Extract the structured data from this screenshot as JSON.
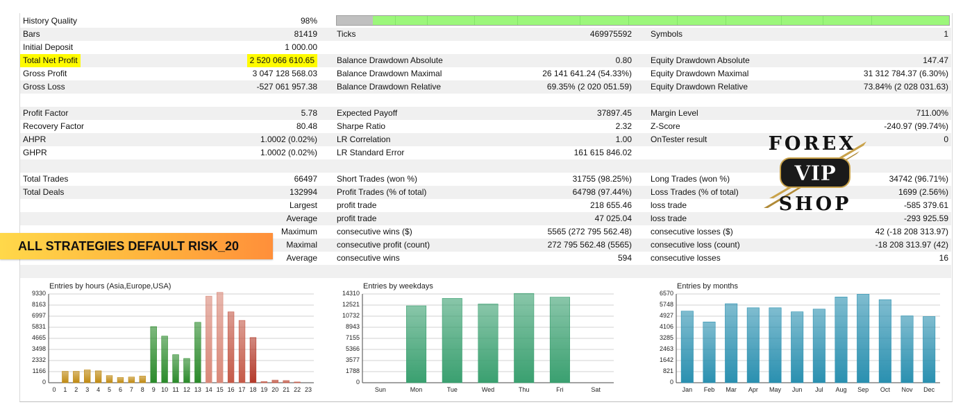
{
  "history": {
    "quality_label": "History Quality",
    "quality_value": "98%",
    "quality_fraction": 0.98
  },
  "stats_rows": [
    {
      "alt": true,
      "c1l": "Bars",
      "c1v": "81419",
      "c2l": "Ticks",
      "c2v": "469975592",
      "c3l": "Symbols",
      "c3v": "1"
    },
    {
      "alt": false,
      "c1l": "Initial Deposit",
      "c1v": "1 000.00",
      "c2l": "",
      "c2v": "",
      "c3l": "",
      "c3v": ""
    },
    {
      "alt": true,
      "c1l": "Total Net Profit",
      "c1v": "2 520 066 610.65",
      "c2l": "Balance Drawdown Absolute",
      "c2v": "0.80",
      "c3l": "Equity Drawdown Absolute",
      "c3v": "147.47",
      "highlight": true
    },
    {
      "alt": false,
      "c1l": "Gross Profit",
      "c1v": "3 047 128 568.03",
      "c2l": "Balance Drawdown Maximal",
      "c2v": "26 141 641.24 (54.33%)",
      "c3l": "Equity Drawdown Maximal",
      "c3v": "31 312 784.37 (6.30%)"
    },
    {
      "alt": true,
      "c1l": "Gross Loss",
      "c1v": "-527 061 957.38",
      "c2l": "Balance Drawdown Relative",
      "c2v": "69.35% (2 020 051.59)",
      "c3l": "Equity Drawdown Relative",
      "c3v": "73.84% (2 028 031.63)"
    },
    {
      "alt": false,
      "c1l": "",
      "c1v": "",
      "c2l": "",
      "c2v": "",
      "c3l": "",
      "c3v": ""
    },
    {
      "alt": true,
      "c1l": "Profit Factor",
      "c1v": "5.78",
      "c2l": "Expected Payoff",
      "c2v": "37897.45",
      "c3l": "Margin Level",
      "c3v": "711.00%"
    },
    {
      "alt": false,
      "c1l": "Recovery Factor",
      "c1v": "80.48",
      "c2l": "Sharpe Ratio",
      "c2v": "2.32",
      "c3l": "Z-Score",
      "c3v": "-240.97 (99.74%)"
    },
    {
      "alt": true,
      "c1l": "AHPR",
      "c1v": "1.0002 (0.02%)",
      "c2l": "LR Correlation",
      "c2v": "1.00",
      "c3l": "OnTester result",
      "c3v": "0"
    },
    {
      "alt": false,
      "c1l": "GHPR",
      "c1v": "1.0002 (0.02%)",
      "c2l": "LR Standard Error",
      "c2v": "161 615 846.02",
      "c3l": "",
      "c3v": ""
    },
    {
      "alt": true,
      "c1l": "",
      "c1v": "",
      "c2l": "",
      "c2v": "",
      "c3l": "",
      "c3v": ""
    },
    {
      "alt": false,
      "c1l": "Total Trades",
      "c1v": "66497",
      "c2l": "Short Trades (won %)",
      "c2v": "31755 (98.25%)",
      "c3l": "Long Trades (won %)",
      "c3v": "34742 (96.71%)"
    },
    {
      "alt": true,
      "c1l": "Total Deals",
      "c1v": "132994",
      "c2l": "Profit Trades (% of total)",
      "c2v": "64798 (97.44%)",
      "c3l": "Loss Trades (% of total)",
      "c3v": "1699 (2.56%)"
    },
    {
      "alt": false,
      "mid": "Largest",
      "c2l": "profit trade",
      "c2v": "218 655.46",
      "c3l": "loss trade",
      "c3v": "-585 379.61"
    },
    {
      "alt": true,
      "mid": "Average",
      "c2l": "profit trade",
      "c2v": "47 025.04",
      "c3l": "loss trade",
      "c3v": "-293 925.59"
    },
    {
      "alt": false,
      "mid": "Maximum",
      "c2l": "consecutive wins ($)",
      "c2v": "5565 (272 795 562.48)",
      "c3l": "consecutive losses ($)",
      "c3v": "42 (-18 208 313.97)"
    },
    {
      "alt": true,
      "mid": "Maximal",
      "c2l": "consecutive profit (count)",
      "c2v": "272 795 562.48 (5565)",
      "c3l": "consecutive loss (count)",
      "c3v": "-18 208 313.97 (42)"
    },
    {
      "alt": false,
      "mid": "Average",
      "c2l": "consecutive wins",
      "c2v": "594",
      "c3l": "consecutive losses",
      "c3v": "16"
    },
    {
      "alt": true,
      "c1l": "",
      "c1v": "",
      "c2l": "",
      "c2v": "",
      "c3l": "",
      "c3v": ""
    }
  ],
  "banner": {
    "text": "ALL STRATEGIES DEFAULT RISK_20"
  },
  "logo": {
    "line1": "FOREX",
    "line2": "VIP",
    "line3": "SHOP",
    "icon": "forex-vip-shop-logo",
    "gold": "#c9a24a"
  },
  "charts": [
    {
      "title": "Entries by hours (Asia,Europe,USA)",
      "y_ticks": [
        "9330",
        "8163",
        "6997",
        "5831",
        "4665",
        "3498",
        "2332",
        "1166",
        "0"
      ],
      "ymax": 9330,
      "categories": [
        "0",
        "1",
        "2",
        "3",
        "4",
        "5",
        "6",
        "7",
        "8",
        "9",
        "10",
        "11",
        "12",
        "13",
        "14",
        "15",
        "16",
        "17",
        "18",
        "19",
        "20",
        "21",
        "22",
        "23"
      ],
      "values": [
        0,
        1200,
        1200,
        1350,
        1250,
        750,
        550,
        600,
        700,
        5900,
        4900,
        2950,
        2550,
        6350,
        9100,
        9500,
        7450,
        6550,
        4750,
        120,
        280,
        230,
        80,
        0
      ],
      "colors": [
        "#c08a12",
        "#c08a12",
        "#c08a12",
        "#c08a12",
        "#c08a12",
        "#c08a12",
        "#c08a12",
        "#c08a12",
        "#c08a12",
        "#2a8a2a",
        "#2a8a2a",
        "#2a8a2a",
        "#2a8a2a",
        "#2a8a2a",
        "#d98878",
        "#d98878",
        "#c55a48",
        "#c55a48",
        "#b43a2a",
        "#c55a48",
        "#c55a48",
        "#c55a48",
        "#c55a48",
        "#c55a48"
      ]
    },
    {
      "title": "Entries by weekdays",
      "y_ticks": [
        "14310",
        "12521",
        "10732",
        "8943",
        "7155",
        "5366",
        "3577",
        "1788",
        "0"
      ],
      "ymax": 14310,
      "categories": [
        "Sun",
        "Mon",
        "Tue",
        "Wed",
        "Thu",
        "Fri",
        "Sat"
      ],
      "values": [
        0,
        12400,
        13600,
        12700,
        14400,
        13800,
        0
      ],
      "colors": [
        "#3aa070",
        "#3aa070",
        "#3aa070",
        "#3aa070",
        "#3aa070",
        "#3aa070",
        "#3aa070"
      ]
    },
    {
      "title": "Entries by months",
      "y_ticks": [
        "6570",
        "5748",
        "4927",
        "4106",
        "3285",
        "2463",
        "1642",
        "821",
        "0"
      ],
      "ymax": 6570,
      "categories": [
        "Jan",
        "Feb",
        "Mar",
        "Apr",
        "May",
        "Jun",
        "Jul",
        "Aug",
        "Sep",
        "Oct",
        "Nov",
        "Dec"
      ],
      "values": [
        5300,
        4500,
        5850,
        5550,
        5550,
        5250,
        5450,
        6350,
        6550,
        6150,
        4950,
        4900
      ],
      "colors": [
        "#2a90b0",
        "#2a90b0",
        "#2a90b0",
        "#2a90b0",
        "#2a90b0",
        "#2a90b0",
        "#2a90b0",
        "#2a90b0",
        "#2a90b0",
        "#2a90b0",
        "#2a90b0",
        "#2a90b0"
      ]
    }
  ]
}
